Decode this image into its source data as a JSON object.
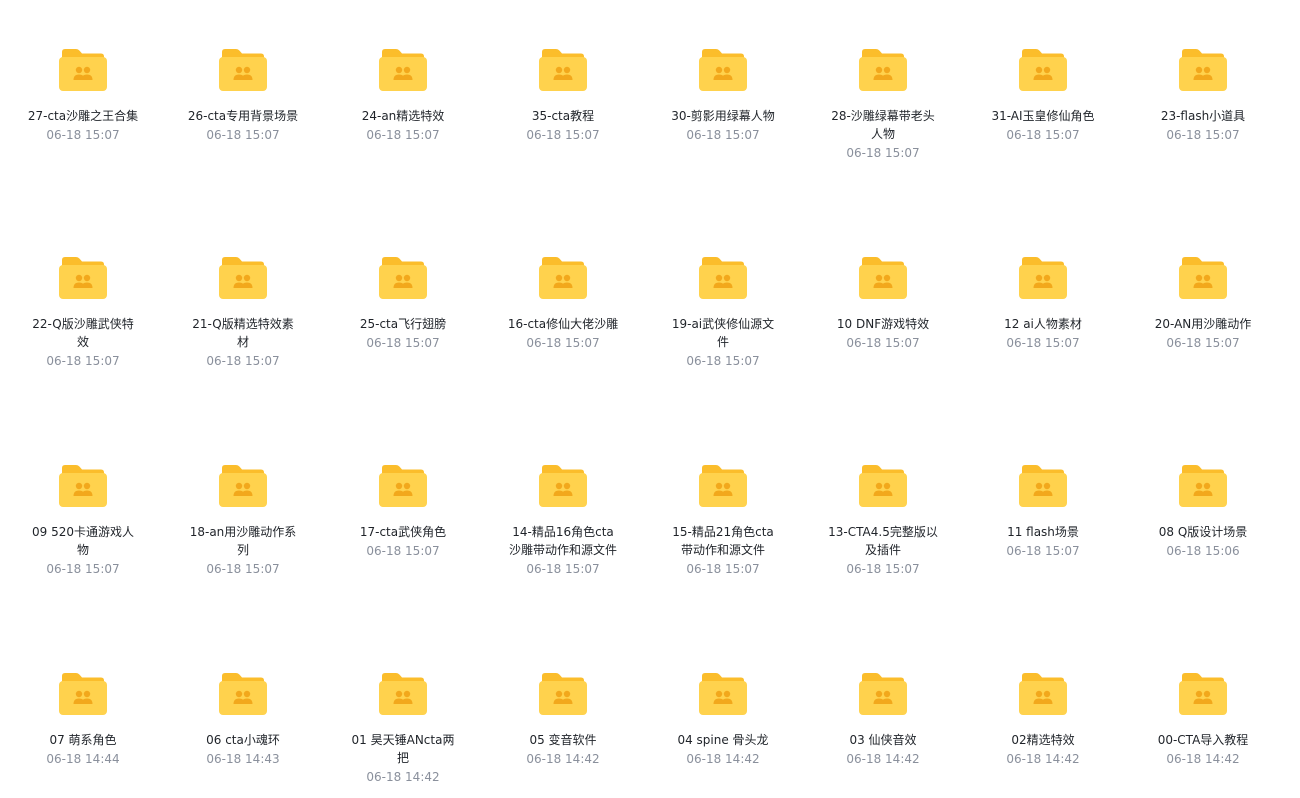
{
  "colors": {
    "folder_back": "#fbbd2b",
    "folder_front": "#ffd24d",
    "folder_emblem": "#f2a81c",
    "text_primary": "#1f2329",
    "text_secondary": "#8a909c"
  },
  "icon": "shared-folder-icon",
  "folders": [
    {
      "name": "27-cta沙雕之王合集",
      "date": "06-18 15:07"
    },
    {
      "name": "26-cta专用背景场景",
      "date": "06-18 15:07"
    },
    {
      "name": "24-an精选特效",
      "date": "06-18 15:07"
    },
    {
      "name": "35-cta教程",
      "date": "06-18 15:07"
    },
    {
      "name": "30-剪影用绿幕人物",
      "date": "06-18 15:07"
    },
    {
      "name": "28-沙雕绿幕带老头人物",
      "date": "06-18 15:07"
    },
    {
      "name": "31-AI玉皇修仙角色",
      "date": "06-18 15:07"
    },
    {
      "name": "23-flash小道具",
      "date": "06-18 15:07"
    },
    {
      "name": "22-Q版沙雕武侠特效",
      "date": "06-18 15:07"
    },
    {
      "name": "21-Q版精选特效素材",
      "date": "06-18 15:07"
    },
    {
      "name": "25-cta飞行翅膀",
      "date": "06-18 15:07"
    },
    {
      "name": "16-cta修仙大佬沙雕",
      "date": "06-18 15:07"
    },
    {
      "name": "19-ai武侠修仙源文件",
      "date": "06-18 15:07"
    },
    {
      "name": "10 DNF游戏特效",
      "date": "06-18 15:07"
    },
    {
      "name": "12 ai人物素材",
      "date": "06-18 15:07"
    },
    {
      "name": "20-AN用沙雕动作",
      "date": "06-18 15:07"
    },
    {
      "name": "09 520卡通游戏人物",
      "date": "06-18 15:07"
    },
    {
      "name": "18-an用沙雕动作系列",
      "date": "06-18 15:07"
    },
    {
      "name": "17-cta武侠角色",
      "date": "06-18 15:07"
    },
    {
      "name": "14-精品16角色cta沙雕带动作和源文件",
      "date": "06-18 15:07"
    },
    {
      "name": "15-精品21角色cta带动作和源文件",
      "date": "06-18 15:07"
    },
    {
      "name": "13-CTA4.5完整版以及插件",
      "date": "06-18 15:07"
    },
    {
      "name": "11 flash场景",
      "date": "06-18 15:07"
    },
    {
      "name": "08 Q版设计场景",
      "date": "06-18 15:06"
    },
    {
      "name": "07 萌系角色",
      "date": "06-18 14:44"
    },
    {
      "name": "06 cta小魂环",
      "date": "06-18 14:43"
    },
    {
      "name": "01 昊天锤ANcta两把",
      "date": "06-18 14:42"
    },
    {
      "name": "05 变音软件",
      "date": "06-18 14:42"
    },
    {
      "name": "04 spine 骨头龙",
      "date": "06-18 14:42"
    },
    {
      "name": "03 仙侠音效",
      "date": "06-18 14:42"
    },
    {
      "name": "02精选特效",
      "date": "06-18 14:42"
    },
    {
      "name": "00-CTA导入教程",
      "date": "06-18 14:42"
    }
  ]
}
